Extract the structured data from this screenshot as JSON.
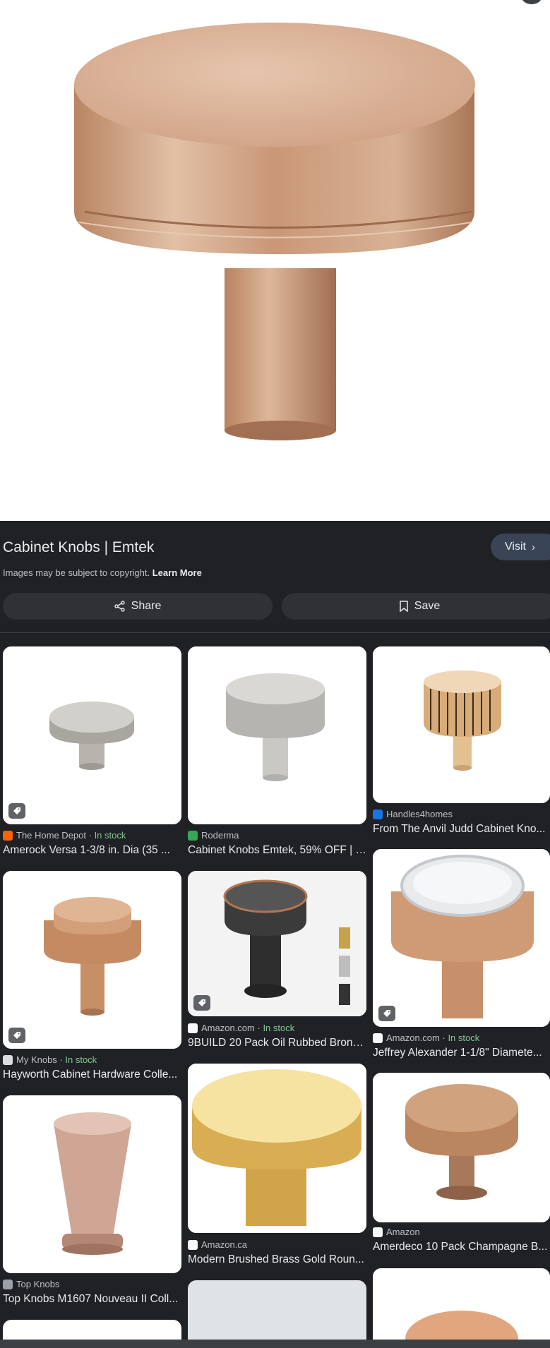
{
  "result": {
    "title": "Cabinet Knobs | Emtek",
    "visit_label": "Visit",
    "copyright_text": "Images may be subject to copyright.",
    "learn_more": "Learn More",
    "share_label": "Share",
    "save_label": "Save"
  },
  "related": [
    {
      "source": "The Home Depot",
      "stock": "In stock",
      "caption": "Amerock Versa 1-3/8 in. Dia (35 ...",
      "fav_color": "#f96302"
    },
    {
      "source": "Roderma",
      "stock": "",
      "caption": "Cabinet Knobs Emtek, 59% OFF | r...",
      "fav_color": "#34a853"
    },
    {
      "source": "Handles4homes",
      "stock": "",
      "caption": "From The Anvil Judd Cabinet Kno...",
      "fav_color": "#1a73e8"
    },
    {
      "source": "Amazon.com",
      "stock": "In stock",
      "caption": "9BUILD 20 Pack Oil Rubbed Bronz...",
      "fav_color": "#f8f9fa"
    },
    {
      "source": "Amazon.com",
      "stock": "In stock",
      "caption": "Jeffrey Alexander 1-1/8\" Diamete...",
      "fav_color": "#f8f9fa"
    },
    {
      "source": "My Knobs",
      "stock": "In stock",
      "caption": "Hayworth Cabinet Hardware Colle...",
      "fav_color": "#dadce0"
    },
    {
      "source": "Amazon.ca",
      "stock": "",
      "caption": "Modern Brushed Brass Gold Roun...",
      "fav_color": "#f8f9fa"
    },
    {
      "source": "Amazon",
      "stock": "",
      "caption": "Amerdeco 10 Pack Champagne B...",
      "fav_color": "#f8f9fa"
    },
    {
      "source": "Top Knobs",
      "stock": "",
      "caption": "Top Knobs M1607 Nouveau II Coll...",
      "fav_color": "#9aa0a6"
    }
  ],
  "colors": {
    "in_stock": "#81c995",
    "visit_bg": "#394457",
    "bronze": "#c69a7a"
  }
}
